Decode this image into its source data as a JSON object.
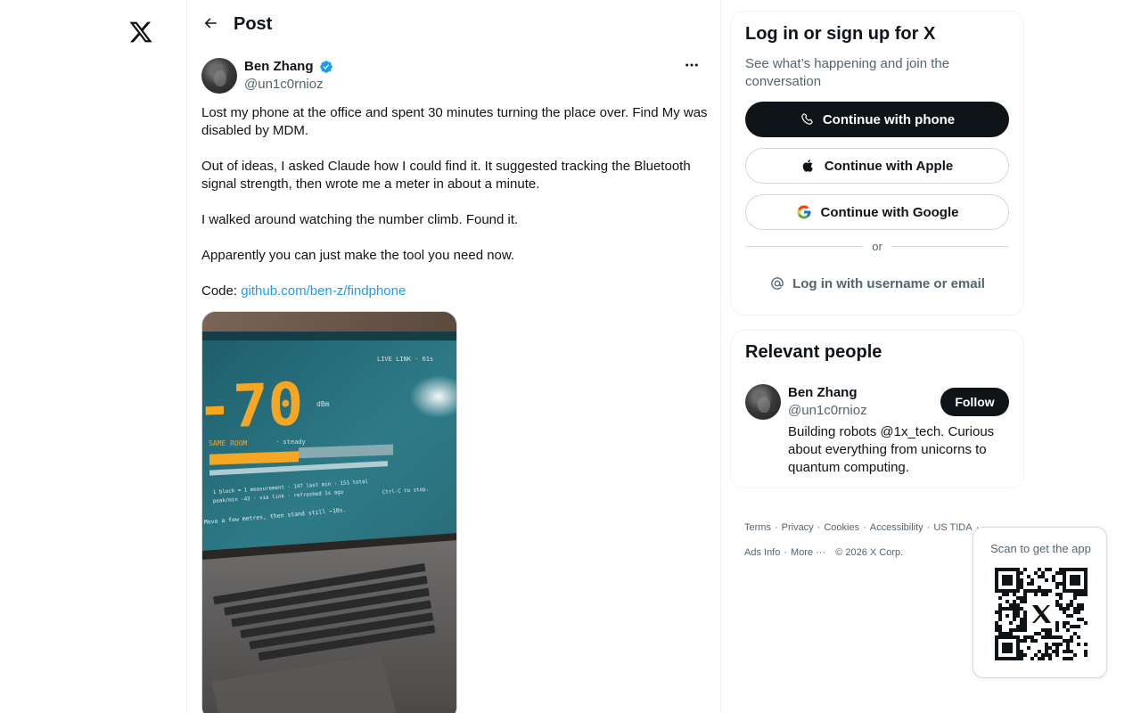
{
  "nav": {
    "logo_icon": "x-logo-icon"
  },
  "header": {
    "back_icon": "arrow-left-icon",
    "title": "Post"
  },
  "post": {
    "author_name": "Ben Zhang",
    "author_handle": "@un1c0rnioz",
    "verified": true,
    "verified_color": "#1d9bf0",
    "more_icon": "more-horizontal-icon",
    "paragraphs": [
      "Lost my phone at the office and spent 30 minutes turning the place over. Find My was disabled by MDM.",
      "Out of ideas, I asked Claude how I could find it. It suggested tracking the Bluetooth signal strength, then wrote me a meter in about a minute.",
      "I walked around watching the number climb. Found it.",
      "Apparently you can just make the tool you need now."
    ],
    "code_prefix": "Code: ",
    "code_link": "github.com/ben-z/findphone",
    "link_color": "#1d9bf0",
    "media": {
      "signal_value": "-70",
      "unit": "dBm",
      "live_label": "LIVE LINK · 61s",
      "status": "SAME ROOM",
      "trend": "· steady",
      "line1": "1 block = 1 measurement · 147 last min · 151 total",
      "line2": "peak/min -43 · via link · refreshed 1s ago",
      "line3": "Ctrl-C to stop.",
      "line4": "Move a few metres, then stand still ~10s."
    }
  },
  "login": {
    "title": "Log in or sign up for X",
    "subtitle": "See what’s happening and join the conversation",
    "phone_button": "Continue with phone",
    "apple_button": "Continue with Apple",
    "google_button": "Continue with Google",
    "or_label": "or",
    "username_button": "Log in with username or email"
  },
  "relevant": {
    "title": "Relevant people",
    "name": "Ben Zhang",
    "handle": "@un1c0rnioz",
    "follow_label": "Follow",
    "bio": "Building robots @1x_tech. Curious about everything from unicorns to quantum computing."
  },
  "footer": {
    "links": [
      "Terms",
      "Privacy",
      "Cookies",
      "Accessibility",
      "US TIDA",
      "Ads Info",
      "More ···"
    ],
    "copyright": "© 2026 X Corp."
  },
  "qr": {
    "label": "Scan to get the app"
  }
}
